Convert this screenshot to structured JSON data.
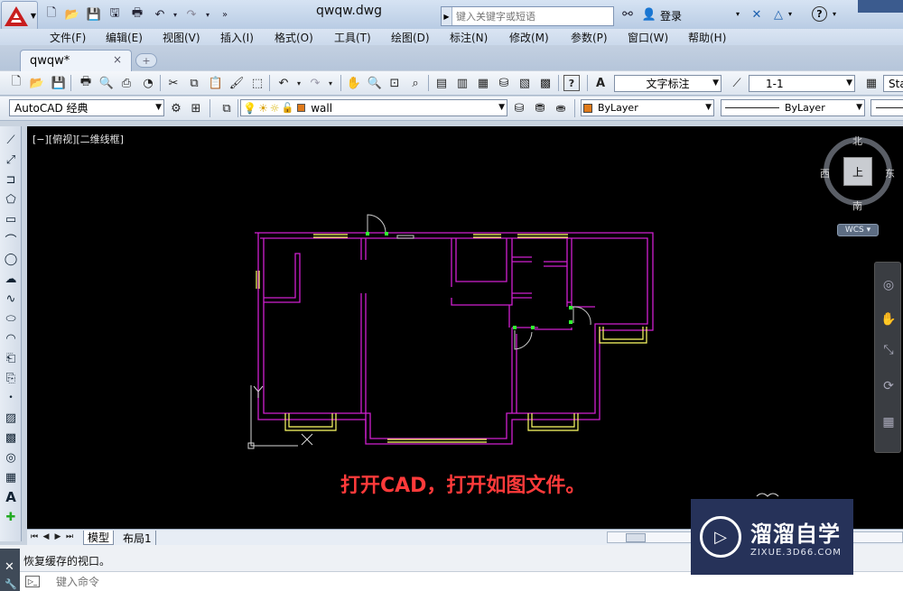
{
  "titlebar": {
    "doc_title": "qwqw.dwg",
    "search_placeholder": "键入关键字或短语",
    "login_label": "登录",
    "help_label": "?"
  },
  "menu": [
    "文件(F)",
    "编辑(E)",
    "视图(V)",
    "插入(I)",
    "格式(O)",
    "工具(T)",
    "绘图(D)",
    "标注(N)",
    "修改(M)",
    "参数(P)",
    "窗口(W)",
    "帮助(H)"
  ],
  "doc_tab": {
    "label": "qwqw*",
    "close": "×"
  },
  "toolbar1": {
    "text_style": "文字标注",
    "dim_style": "1-1",
    "table_style": "Sta"
  },
  "toolbar2": {
    "workspace": "AutoCAD 经典",
    "layer": "wall",
    "color": "ByLayer",
    "linetype": "ByLayer"
  },
  "viewport": {
    "view_label": "[−][俯视][二维线框]",
    "compass": {
      "north": "北",
      "south": "南",
      "east": "东",
      "west": "西",
      "top": "上"
    },
    "wcs": "WCS ▾",
    "caption": "打开CAD，打开如图文件。"
  },
  "layout_tabs": {
    "model": "模型",
    "layout1": "布局1"
  },
  "command": {
    "history": "恢复缓存的视口。",
    "placeholder": "键入命令"
  },
  "watermark": {
    "title": "溜溜自学",
    "sub": "ZIXUE.3D66.COM"
  },
  "colors": {
    "wall": "#d020d0",
    "window": "#ffff66",
    "door": "#cccccc",
    "grip": "#30ff30",
    "caption": "#ff3a3a"
  }
}
